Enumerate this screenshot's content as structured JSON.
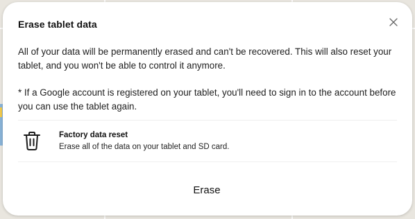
{
  "dialog": {
    "title": "Erase tablet data",
    "close_icon": "close-icon",
    "paragraphs": [
      "All of your data will be permanently erased and can't be recovered. This will also reset your tablet, and you won't be able to control it anymore.",
      "* If a Google account is registered on your tablet, you'll need to sign in to the account before you can use the tablet again."
    ],
    "option": {
      "icon": "trash-icon",
      "title": "Factory data reset",
      "description": "Erase all of the data on your tablet and SD card."
    },
    "erase_label": "Erase"
  },
  "colors": {
    "dialog_background": "#ffffff",
    "text": "#202020",
    "backdrop": "#e9e6df"
  }
}
